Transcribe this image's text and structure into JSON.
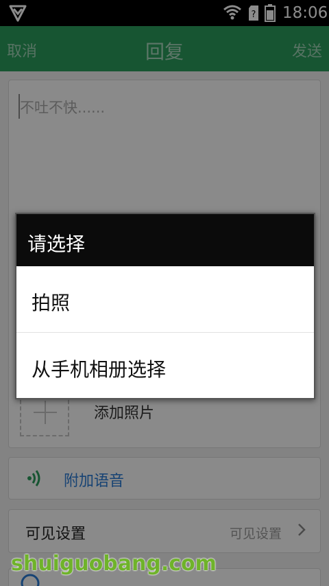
{
  "status_bar": {
    "time": "18:06",
    "icons": [
      "shield-icon",
      "wifi-icon",
      "sim-unknown-icon",
      "battery-icon"
    ]
  },
  "app_bar": {
    "cancel_label": "取消",
    "title": "回复",
    "send_label": "发送"
  },
  "compose": {
    "placeholder": "不吐不快......"
  },
  "photo": {
    "add_label": "添加照片"
  },
  "voice": {
    "label": "附加语音"
  },
  "visibility": {
    "label": "可见设置",
    "value": "可见设置"
  },
  "dialog": {
    "title": "请选择",
    "options": [
      "拍照",
      "从手机相册选择"
    ]
  },
  "watermark": {
    "text": "shuiguobang.com"
  },
  "colors": {
    "accent": "#2b9b5c",
    "link": "#2b7bd3"
  }
}
